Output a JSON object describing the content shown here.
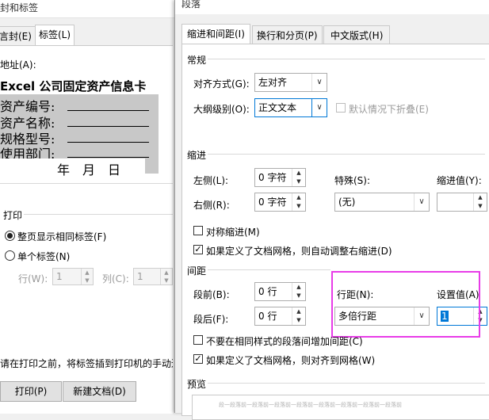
{
  "background_dialog": {
    "title": "封和标签",
    "tabs": [
      "言封(E)",
      "标签(L)"
    ],
    "address_label": "地址(A):",
    "address_lines": [
      "Excel 公司固定资产信息卡",
      "资产编号:",
      "资产名称:",
      "规格型号:",
      "使用部门:",
      "年　月　日"
    ],
    "print_section": "打印",
    "radio_full_page": "整页显示相同标签(F)",
    "radio_single": "单个标签(N)",
    "row_label": "行(W):",
    "row_value": "1",
    "col_label": "列(C):",
    "col_value": "1",
    "hint_text": "请在打印之前，将标签插到打印机的手动进",
    "print_button": "打印(P)",
    "new_doc_button": "新建文档(D)"
  },
  "paragraph_dialog": {
    "title": "段落",
    "tabs": [
      "缩进和间距(I)",
      "换行和分页(P)",
      "中文版式(H)"
    ],
    "general": {
      "title": "常规",
      "alignment_label": "对齐方式(G):",
      "alignment_value": "左对齐",
      "outline_label": "大纲级别(O):",
      "outline_value": "正文文本",
      "collapse_label": "默认情况下折叠(E)"
    },
    "indent": {
      "title": "缩进",
      "left_label": "左侧(L):",
      "left_value": "0 字符",
      "right_label": "右侧(R):",
      "right_value": "0 字符",
      "special_label": "特殊(S):",
      "special_value": "(无)",
      "indent_value_label": "缩进值(Y):",
      "indent_value": "",
      "mirror_label": "对称缩进(M)",
      "auto_adjust_label": "如果定义了文档网格，则自动调整右缩进(D)"
    },
    "spacing": {
      "title": "间距",
      "before_label": "段前(B):",
      "before_value": "0 行",
      "after_label": "段后(F):",
      "after_value": "0 行",
      "line_spacing_label": "行距(N):",
      "line_spacing_value": "多倍行距",
      "set_value_label": "设置值(A)",
      "set_value": "1",
      "no_space_same_style_label": "不要在相同样式的段落间增加间距(C)",
      "snap_grid_label": "如果定义了文档网格，则对齐到网格(W)"
    },
    "preview": {
      "title": "预览",
      "sample": "段一段落前一段落前一段落前一段落前一段落前一段落前一段落前一段落前"
    }
  },
  "colors": {
    "highlight": "#e83ce8",
    "focus_blue": "#0078d7"
  }
}
